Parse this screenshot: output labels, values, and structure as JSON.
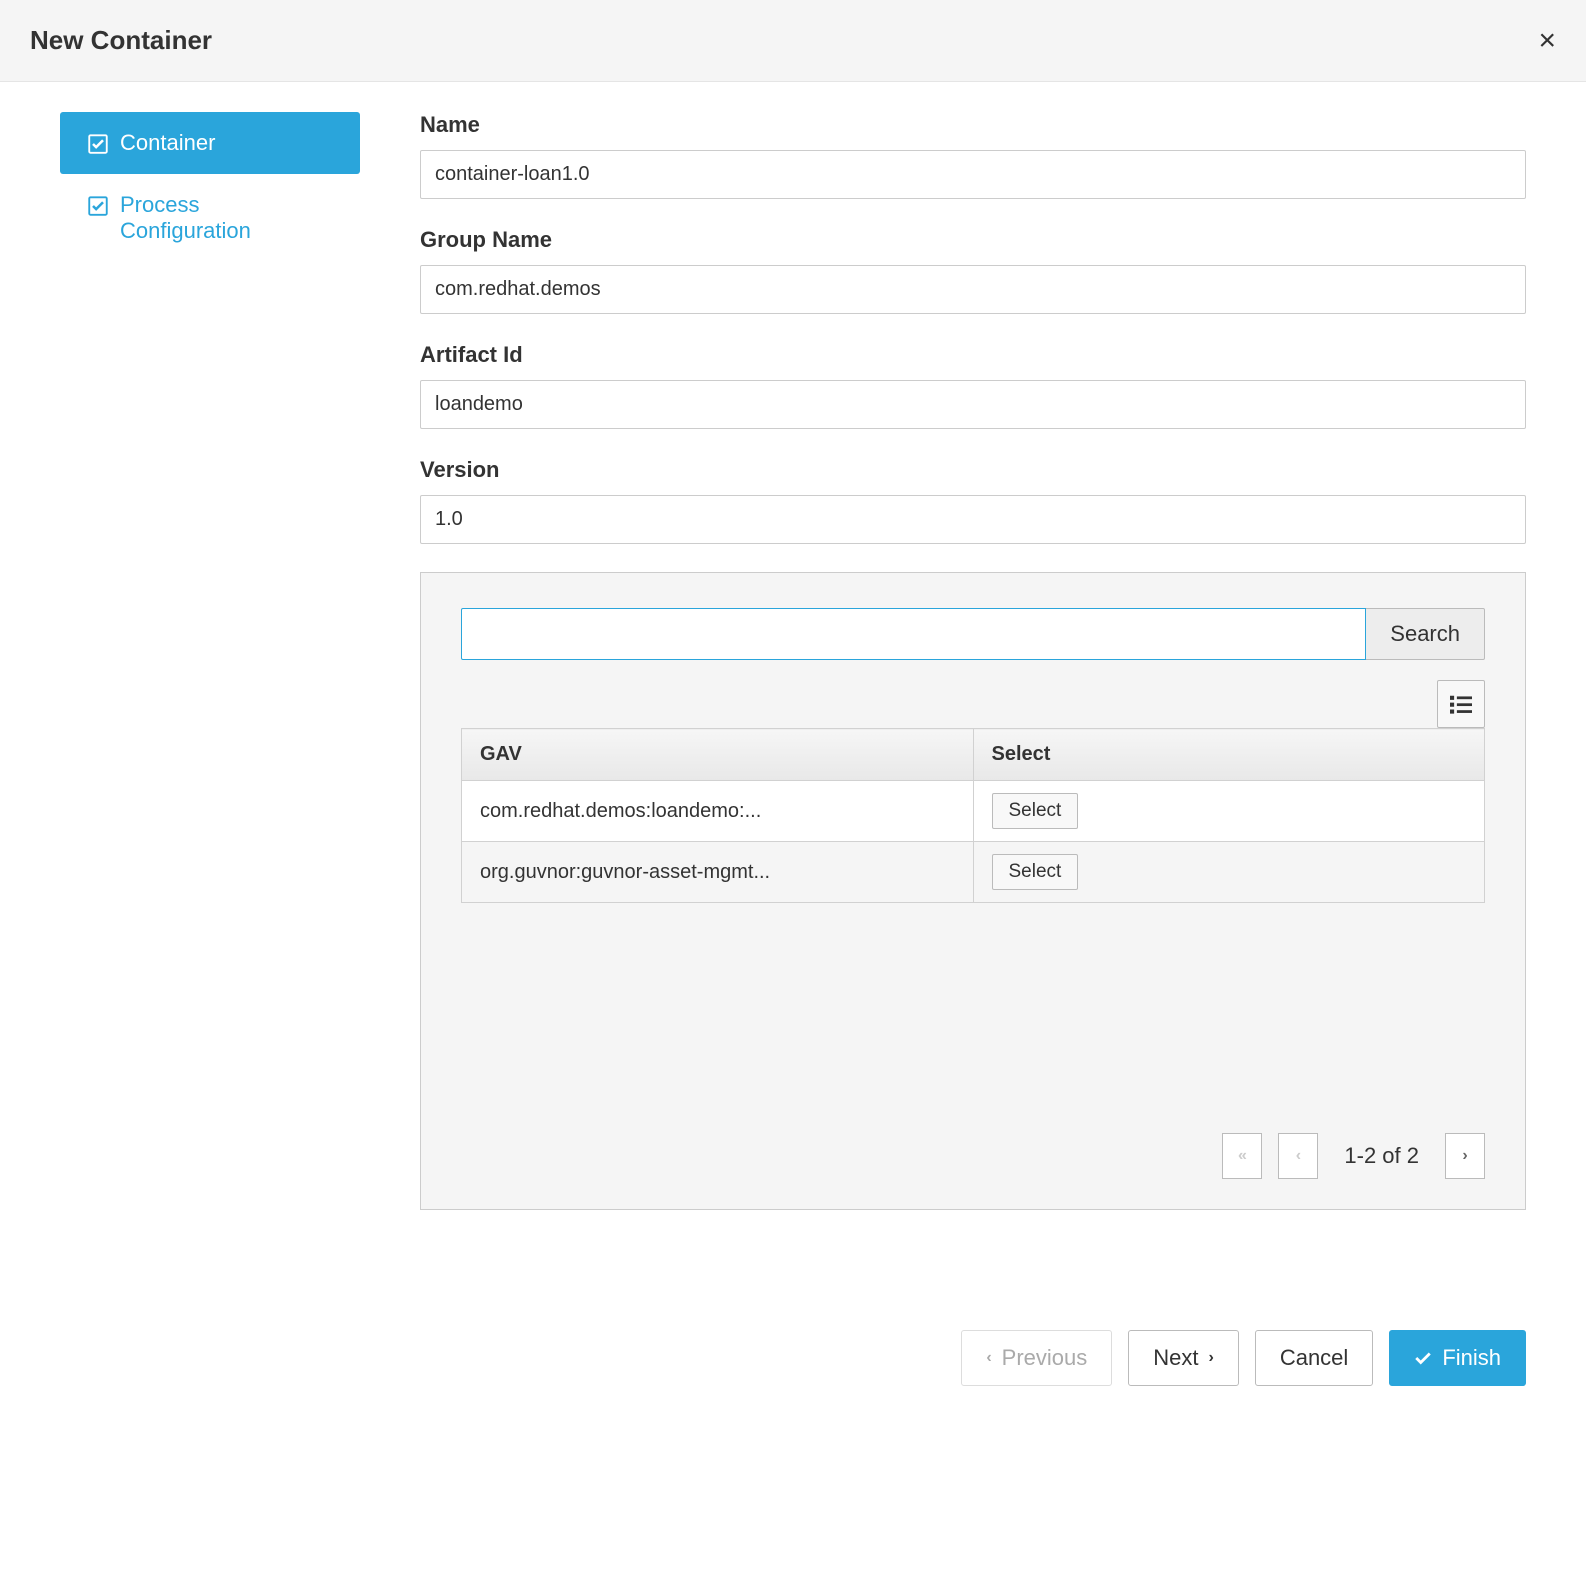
{
  "modal": {
    "title": "New Container"
  },
  "sidebar": {
    "items": [
      {
        "label": "Container",
        "active": true
      },
      {
        "label": "Process Configuration",
        "active": false
      }
    ]
  },
  "form": {
    "name": {
      "label": "Name",
      "value": "container-loan1.0"
    },
    "group_name": {
      "label": "Group Name",
      "value": "com.redhat.demos"
    },
    "artifact_id": {
      "label": "Artifact Id",
      "value": "loandemo"
    },
    "version": {
      "label": "Version",
      "value": "1.0"
    }
  },
  "search": {
    "value": "",
    "button": "Search"
  },
  "table": {
    "columns": {
      "gav": "GAV",
      "select": "Select"
    },
    "rows": [
      {
        "gav": "com.redhat.demos:loandemo:..."
      },
      {
        "gav": "org.guvnor:guvnor-asset-mgmt..."
      }
    ],
    "select_label": "Select"
  },
  "pagination": {
    "info": "1-2 of 2"
  },
  "footer": {
    "previous": "Previous",
    "next": "Next",
    "cancel": "Cancel",
    "finish": "Finish"
  }
}
